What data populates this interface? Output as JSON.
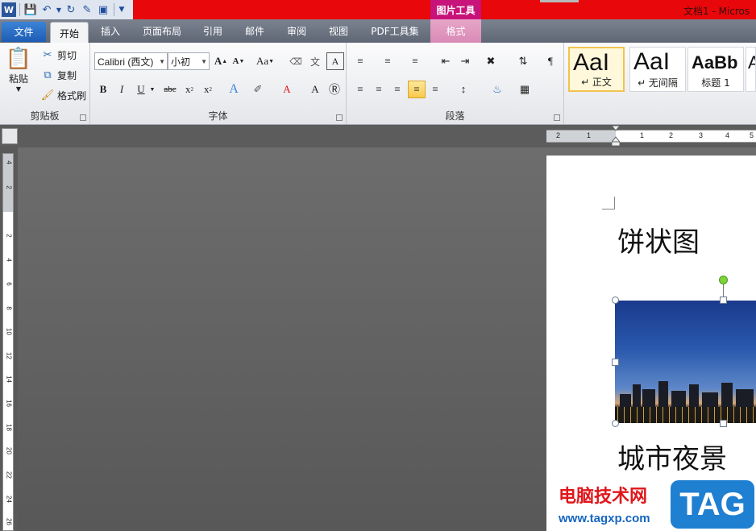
{
  "title_bar": {
    "context_tab_title": "图片工具",
    "document_title": "文档1 - Micros"
  },
  "tabs": {
    "file": "文件",
    "items": [
      "开始",
      "插入",
      "页面布局",
      "引用",
      "邮件",
      "审阅",
      "视图",
      "PDF工具集"
    ],
    "context": "格式"
  },
  "clipboard": {
    "paste": "粘贴",
    "cut": "剪切",
    "copy": "复制",
    "format_painter": "格式刷",
    "label": "剪贴板"
  },
  "font": {
    "font_name": "Calibri (西文)",
    "font_size": "小初",
    "change_case": "Aa",
    "label": "字体"
  },
  "paragraph": {
    "label": "段落"
  },
  "styles": {
    "items": [
      {
        "sample": "AaI",
        "name": "↵ 正文"
      },
      {
        "sample": "AaI",
        "name": "↵ 无间隔"
      },
      {
        "sample": "AaBb",
        "name": "标题 1"
      },
      {
        "sample": "A",
        "name": ""
      }
    ]
  },
  "rulers": {
    "horizontal": [
      "2",
      "1",
      "1",
      "2",
      "3",
      "4",
      "5",
      "6",
      "7"
    ],
    "vertical": [
      "4",
      "2",
      "2",
      "4",
      "6",
      "8",
      "10",
      "12",
      "14",
      "16",
      "18",
      "20",
      "22",
      "24",
      "26"
    ]
  },
  "document": {
    "heading": "饼状图",
    "caption": "城市夜景"
  },
  "watermark": {
    "site_name": "电脑技术网",
    "url": "www.tagxp.com",
    "badge": "TAG"
  }
}
